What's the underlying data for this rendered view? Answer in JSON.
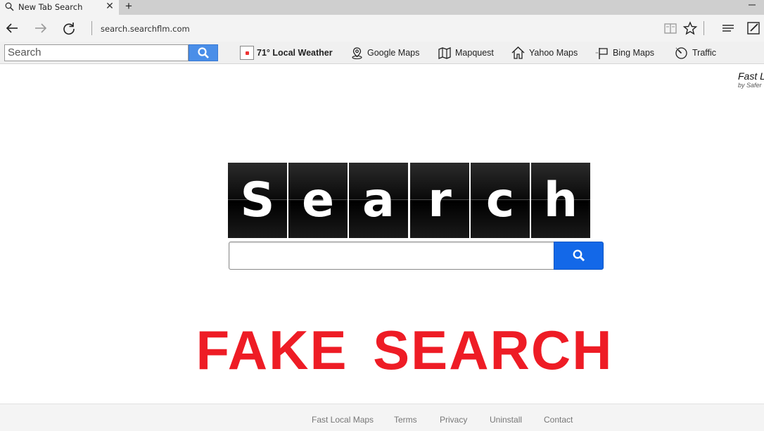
{
  "browser": {
    "tab_title": "New Tab Search",
    "url": "search.searchflm.com"
  },
  "toolbar": {
    "search_placeholder": "Search",
    "weather_label": "71° Local Weather",
    "items": [
      "Google Maps",
      "Mapquest",
      "Yahoo Maps",
      "Bing Maps",
      "Traffic"
    ]
  },
  "brand": {
    "name": "Fast L",
    "sub": "by Safer"
  },
  "logo": {
    "letters": [
      "S",
      "e",
      "a",
      "r",
      "c",
      "h"
    ]
  },
  "watermark": {
    "text": "FAKE SEARCH",
    "color": "#ee1c25"
  },
  "footer": {
    "links": [
      "Fast Local Maps",
      "Terms",
      "Privacy",
      "Uninstall",
      "Contact"
    ]
  },
  "colors": {
    "toolbar_search_button": "#4a8ee8",
    "main_search_button": "#1368e8"
  }
}
